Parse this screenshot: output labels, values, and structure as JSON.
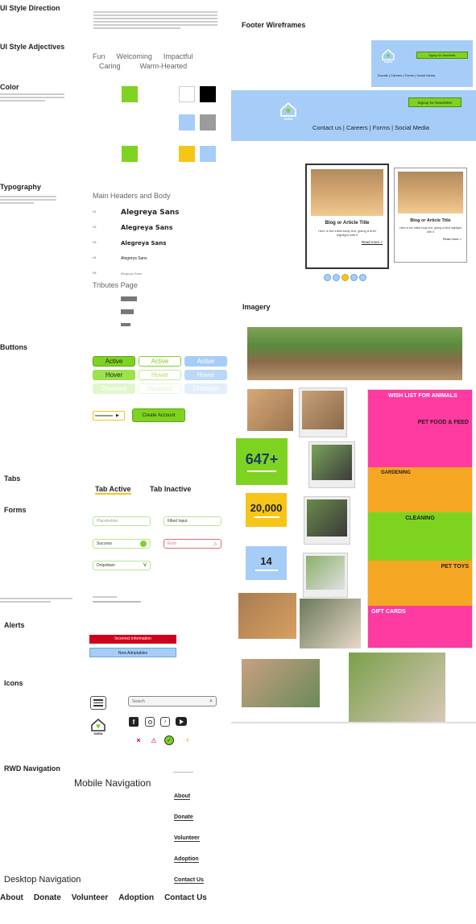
{
  "sections": {
    "ui_style_direction": "UI Style Direction",
    "ui_style_adjectives": "UI Style Adjectives",
    "color": "Color",
    "typography": "Typography",
    "buttons": "Buttons",
    "tabs": "Tabs",
    "forms": "Forms",
    "alerts": "Alerts",
    "icons": "Icons",
    "rwd_navigation": "RWD Navigation",
    "footer_wireframes": "Footer Wireframes",
    "imagery": "Imagery"
  },
  "adjectives": {
    "row1": [
      "Fun",
      "Welcoming",
      "Impactful"
    ],
    "row2": [
      "Caring",
      "Warm-Hearted"
    ]
  },
  "colors": {
    "green": "#7ED321",
    "white": "#FFFFFF",
    "black": "#000000",
    "light_blue": "#A6CDF7",
    "gray": "#9B9B9B",
    "yellow": "#F5C518"
  },
  "typography": {
    "heading": "Main Headers and Body",
    "sizes": [
      "H1",
      "H2",
      "H3",
      "H4",
      "H5"
    ],
    "samples": [
      "Alegreya Sans",
      "Alegreya Sans",
      "Alegreya Sans",
      "Alegreya Sans",
      "Alegreya Sans"
    ],
    "tributes_heading": "Tributes Page"
  },
  "buttons": {
    "labels": [
      "Active",
      "Hover",
      "Disabled"
    ],
    "create_account": "Create Account"
  },
  "tabs": {
    "active": "Tab Active",
    "inactive": "Tab Inactive"
  },
  "forms": {
    "placeholder": "Placeholder",
    "filled_input": "Filled Input",
    "success": "Success",
    "error": "Error",
    "dropdown": "Dropdown",
    "dropdown_chevron": "V"
  },
  "alerts": {
    "error": "Incorrect information",
    "info": "New Adoptables"
  },
  "icons": {
    "search_placeholder": "Search",
    "logo_text": "SARA"
  },
  "navigation": {
    "mobile_heading": "Mobile Navigation",
    "desktop_heading": "Desktop Navigation",
    "items": [
      "About",
      "Donate",
      "Volunteer",
      "Adoption",
      "Contact Us"
    ]
  },
  "footer": {
    "signup": "Signup for Newsletter",
    "links": "Donate | Careers | Forms | Social Media",
    "links_large": "Contact us | Careers | Forms | Social Media",
    "logo_text": "SARA"
  },
  "blog": {
    "card_title": "Blog or Article Title",
    "card_body": "Here is the initial body text, giving a brief highlight with it",
    "read_more": "Read more >"
  },
  "imagery": {
    "stat1": "647+",
    "stat2": "20,000",
    "stat3": "14",
    "wishlist_title": "WISH LIST FOR ANIMALS",
    "wishlist_sections": [
      "PET FOOD & FEED",
      "GARDENING",
      "CLEANING",
      "PET TOYS",
      "GIFT CARDS"
    ]
  }
}
